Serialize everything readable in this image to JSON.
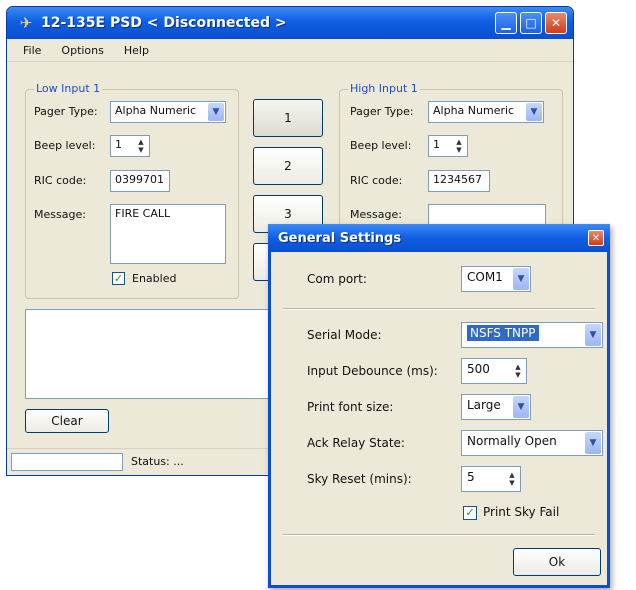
{
  "main_window": {
    "title": "12-135E PSD < Disconnected >",
    "menu": [
      "File",
      "Options",
      "Help"
    ],
    "low_input": {
      "group_title": "Low Input 1",
      "pager_type_label": "Pager Type:",
      "pager_type_value": "Alpha Numeric",
      "beep_level_label": "Beep level:",
      "beep_level_value": "1",
      "ric_code_label": "RIC code:",
      "ric_code_value": "0399701",
      "message_label": "Message:",
      "message_value": "FIRE CALL",
      "enabled_label": "Enabled",
      "enabled_checked": true
    },
    "high_input": {
      "group_title": "High Input 1",
      "pager_type_label": "Pager Type:",
      "pager_type_value": "Alpha Numeric",
      "beep_level_label": "Beep level:",
      "beep_level_value": "1",
      "ric_code_label": "RIC code:",
      "ric_code_value": "1234567",
      "message_label": "Message:",
      "message_value": ""
    },
    "input_buttons": [
      "1",
      "2",
      "3"
    ],
    "clear_button": "Clear",
    "status_label": "Status: ..."
  },
  "settings_dialog": {
    "title": "General Settings",
    "com_port_label": "Com port:",
    "com_port_value": "COM1",
    "serial_mode_label": "Serial Mode:",
    "serial_mode_value": "NSFS TNPP",
    "input_debounce_label": "Input Debounce (ms):",
    "input_debounce_value": "500",
    "print_font_size_label": "Print font size:",
    "print_font_size_value": "Large",
    "ack_relay_label": "Ack Relay State:",
    "ack_relay_value": "Normally Open",
    "sky_reset_label": "Sky Reset (mins):",
    "sky_reset_value": "5",
    "print_sky_fail_label": "Print Sky Fail",
    "print_sky_fail_checked": true,
    "ok_button": "Ok"
  },
  "colors": {
    "titlebar_blue": "#0f5fe3",
    "window_bg": "#ece9d8",
    "group_title": "#1e4dc6",
    "checkbox_tick": "#21a121",
    "close_red": "#d23a1a"
  },
  "icons": {
    "app": "pager-icon",
    "minimize": "minimize-icon",
    "maximize": "maximize-icon",
    "close": "close-icon",
    "dropdown": "chevron-down-icon",
    "spinner": "spin-arrows-icon",
    "check": "checkmark-icon"
  }
}
